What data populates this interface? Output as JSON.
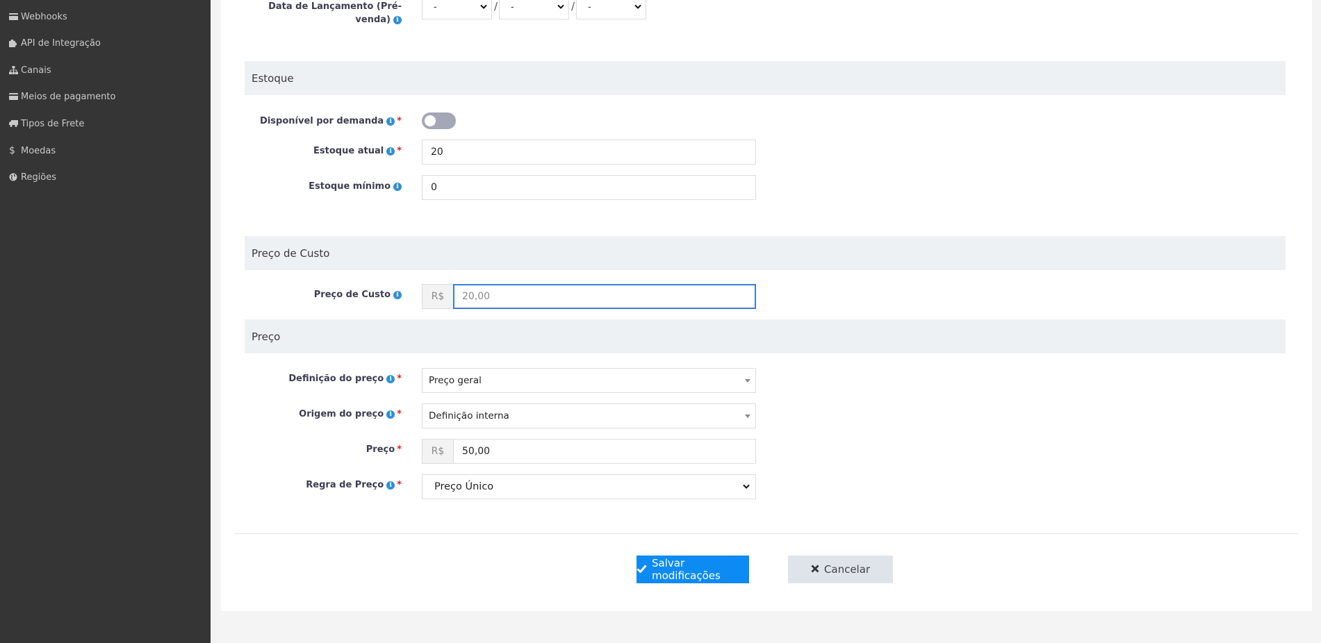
{
  "sidebar": {
    "items": [
      {
        "label": "Webhooks",
        "icon": "credit-card-icon"
      },
      {
        "label": "API de Integração",
        "icon": "puzzle-icon"
      },
      {
        "label": "Canais",
        "icon": "sitemap-icon"
      },
      {
        "label": "Meios de pagamento",
        "icon": "credit-card-icon"
      },
      {
        "label": "Tipos de Frete",
        "icon": "truck-icon"
      },
      {
        "label": "Moedas",
        "icon": "dollar-icon"
      },
      {
        "label": "Regiões",
        "icon": "globe-icon"
      }
    ]
  },
  "release_date": {
    "label_line1": "Data de Lançamento (Pré-",
    "label_line2": "venda)",
    "day": "-",
    "month": "-",
    "year": "-",
    "separator": "/"
  },
  "stock": {
    "header": "Estoque",
    "on_demand_label": "Disponível por demanda",
    "on_demand_enabled": false,
    "current_label": "Estoque atual",
    "current_value": "20",
    "min_label": "Estoque mínimo",
    "min_value": "0"
  },
  "cost": {
    "header": "Preço de Custo",
    "label": "Preço de Custo",
    "currency": "R$",
    "value": "20,00"
  },
  "price": {
    "header": "Preço",
    "definition_label": "Definição do preço",
    "definition_value": "Preço geral",
    "origin_label": "Origem do preço",
    "origin_value": "Definição interna",
    "price_label": "Preço",
    "currency": "R$",
    "price_value": "50,00",
    "rule_label": "Regra de Preço",
    "rule_value": "Preço Único"
  },
  "actions": {
    "save_label": "Salvar modificações",
    "cancel_label": "Cancelar"
  },
  "symbols": {
    "info": "i",
    "required": "*"
  },
  "colors": {
    "sidebar_bg": "#353535",
    "primary": "#0d8bf2",
    "section_bg": "#eef1f4",
    "required": "#e02020",
    "info": "#2f8fd6"
  }
}
